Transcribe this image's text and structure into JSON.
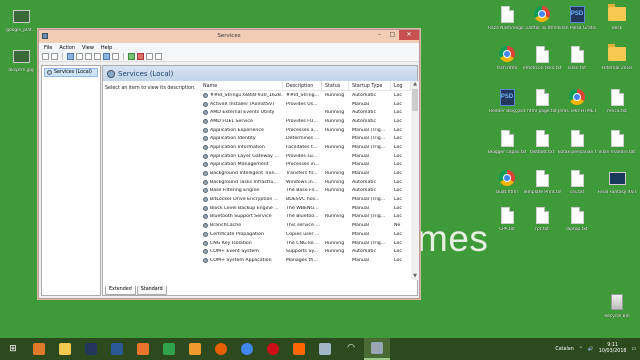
{
  "desktop": {
    "background_text": "mes",
    "left_icons": [
      {
        "label": "google_plat..."
      },
      {
        "label": "aksjzrm.jpg"
      }
    ],
    "icons": [
      {
        "label": "Raza Nastimegir...",
        "kind": "doc"
      },
      {
        "label": "Daftar isi.html",
        "kind": "chrome"
      },
      {
        "label": "Iklan Pulsa Gratis.psd",
        "kind": "ps"
      },
      {
        "label": "desk",
        "kind": "folder"
      },
      {
        "label": "fsch.html",
        "kind": "chrome"
      },
      {
        "label": "emoticon teks.txt",
        "kind": "doc"
      },
      {
        "label": "iklan.txt",
        "kind": "doc"
      },
      {
        "label": "Hiternal 2018",
        "kind": "folder"
      },
      {
        "label": "Header Blog.psd",
        "kind": "ps"
      },
      {
        "label": "html page.txt",
        "kind": "doc"
      },
      {
        "label": "Jeras Teks HTML.html",
        "kind": "chrome"
      },
      {
        "label": "renca.txt",
        "kind": "doc"
      },
      {
        "label": "Blogger copas.txt",
        "kind": "doc"
      },
      {
        "label": "fastbott.txt",
        "kind": "doc"
      },
      {
        "label": "kotak pencarian.txt",
        "kind": "doc"
      },
      {
        "label": "iklan mandiri.txt",
        "kind": "doc"
      },
      {
        "label": "buat.html",
        "kind": "chrome"
      },
      {
        "label": "Template Print.txt",
        "kind": "doc"
      },
      {
        "label": "css.txt",
        "kind": "doc"
      },
      {
        "label": "Final Fantasy XV.Camp.jpg",
        "kind": "img"
      },
      {
        "label": "CPA.txt",
        "kind": "doc"
      },
      {
        "label": "rpt.txt",
        "kind": "doc"
      },
      {
        "label": "laptop.txt",
        "kind": "doc"
      },
      {
        "label": "Recycle Bin",
        "kind": "recycle"
      }
    ]
  },
  "window": {
    "title": "Services",
    "controls": {
      "minimize": "–",
      "maximize": "□",
      "close": "✕"
    },
    "menu": [
      "File",
      "Action",
      "View",
      "Help"
    ],
    "tree": {
      "selected": "Services (Local)"
    },
    "header_title": "Services (Local)",
    "description_prompt": "Select an item to view its description.",
    "columns": [
      "Name",
      "Description",
      "Status",
      "Startup Type",
      "Log"
    ],
    "rows": [
      {
        "name": "##Id_String1.6844F930_1628...",
        "desc": "##Id_String...",
        "status": "Running",
        "startup": "Automatic",
        "log": "Loc"
      },
      {
        "name": "ActiveX Installer (AxInstSV)",
        "desc": "Provides Us...",
        "status": "",
        "startup": "Manual",
        "log": "Loc"
      },
      {
        "name": "AMD External Events Utility",
        "desc": "",
        "status": "Running",
        "startup": "Automatic",
        "log": "Loc"
      },
      {
        "name": "AMD FUEL Service",
        "desc": "Provides FU...",
        "status": "Running",
        "startup": "Automatic",
        "log": "Loc"
      },
      {
        "name": "Application Experience",
        "desc": "Processes a...",
        "status": "Running",
        "startup": "Manual (Trig...",
        "log": "Loc"
      },
      {
        "name": "Application Identity",
        "desc": "Determines ...",
        "status": "",
        "startup": "Manual (Trig...",
        "log": "Loc"
      },
      {
        "name": "Application Information",
        "desc": "Facilitates t...",
        "status": "Running",
        "startup": "Manual (Trig...",
        "log": "Loc"
      },
      {
        "name": "Application Layer Gateway ...",
        "desc": "Provides su...",
        "status": "",
        "startup": "Manual",
        "log": "Loc"
      },
      {
        "name": "Application Management",
        "desc": "Processes in...",
        "status": "",
        "startup": "Manual",
        "log": "Loc"
      },
      {
        "name": "Background Intelligent Tran...",
        "desc": "Transfers fil...",
        "status": "Running",
        "startup": "Manual",
        "log": "Loc"
      },
      {
        "name": "Background Tasks Infrastru...",
        "desc": "Windows in...",
        "status": "Running",
        "startup": "Automatic",
        "log": "Loc"
      },
      {
        "name": "Base Filtering Engine",
        "desc": "The Base Fil...",
        "status": "Running",
        "startup": "Automatic",
        "log": "Loc"
      },
      {
        "name": "BitLocker Drive Encryption ...",
        "desc": "BDESVC hos...",
        "status": "",
        "startup": "Manual (Trig...",
        "log": "Loc"
      },
      {
        "name": "Block Level Backup Engine ...",
        "desc": "The WBENG...",
        "status": "",
        "startup": "Manual",
        "log": "Loc"
      },
      {
        "name": "Bluetooth Support Service",
        "desc": "The Bluetoo...",
        "status": "Running",
        "startup": "Manual (Trig...",
        "log": "Loc"
      },
      {
        "name": "BranchCache",
        "desc": "This service ...",
        "status": "",
        "startup": "Manual",
        "log": "Ne"
      },
      {
        "name": "Certificate Propagation",
        "desc": "Copies user ...",
        "status": "",
        "startup": "Manual",
        "log": "Loc"
      },
      {
        "name": "CNG Key Isolation",
        "desc": "The CNG ke...",
        "status": "Running",
        "startup": "Manual (Trig...",
        "log": "Loc"
      },
      {
        "name": "COM+ Event System",
        "desc": "Supports Sy...",
        "status": "Running",
        "startup": "Automatic",
        "log": "Loc"
      },
      {
        "name": "COM+ System Application",
        "desc": "Manages th...",
        "status": "",
        "startup": "Manual",
        "log": "Loc"
      }
    ],
    "tabs": [
      "Extended",
      "Standard"
    ]
  },
  "taskbar": {
    "apps": [
      {
        "name": "start",
        "color": "#2d4a1e"
      },
      {
        "name": "windows-media",
        "color": "#e07a2a"
      },
      {
        "name": "file-explorer",
        "color": "#f3c94f"
      },
      {
        "name": "photoshop",
        "color": "#23365b"
      },
      {
        "name": "word",
        "color": "#2b5797"
      },
      {
        "name": "wps-presentation",
        "color": "#e9742b"
      },
      {
        "name": "wps-spreadsheet",
        "color": "#2fa24d"
      },
      {
        "name": "sublime",
        "color": "#f09a2e"
      },
      {
        "name": "firefox",
        "color": "#e66000"
      },
      {
        "name": "chrome",
        "color": "#4285f4"
      },
      {
        "name": "opera",
        "color": "#cc0f16"
      },
      {
        "name": "xiaomi",
        "color": "#ff6700"
      },
      {
        "name": "tool",
        "color": "#9fb6c9"
      },
      {
        "name": "wifi",
        "color": "#ffffff"
      },
      {
        "name": "services",
        "color": "#9aa6b4"
      }
    ],
    "language": "Catalan",
    "time": "9:11",
    "date": "10/03/2018"
  }
}
